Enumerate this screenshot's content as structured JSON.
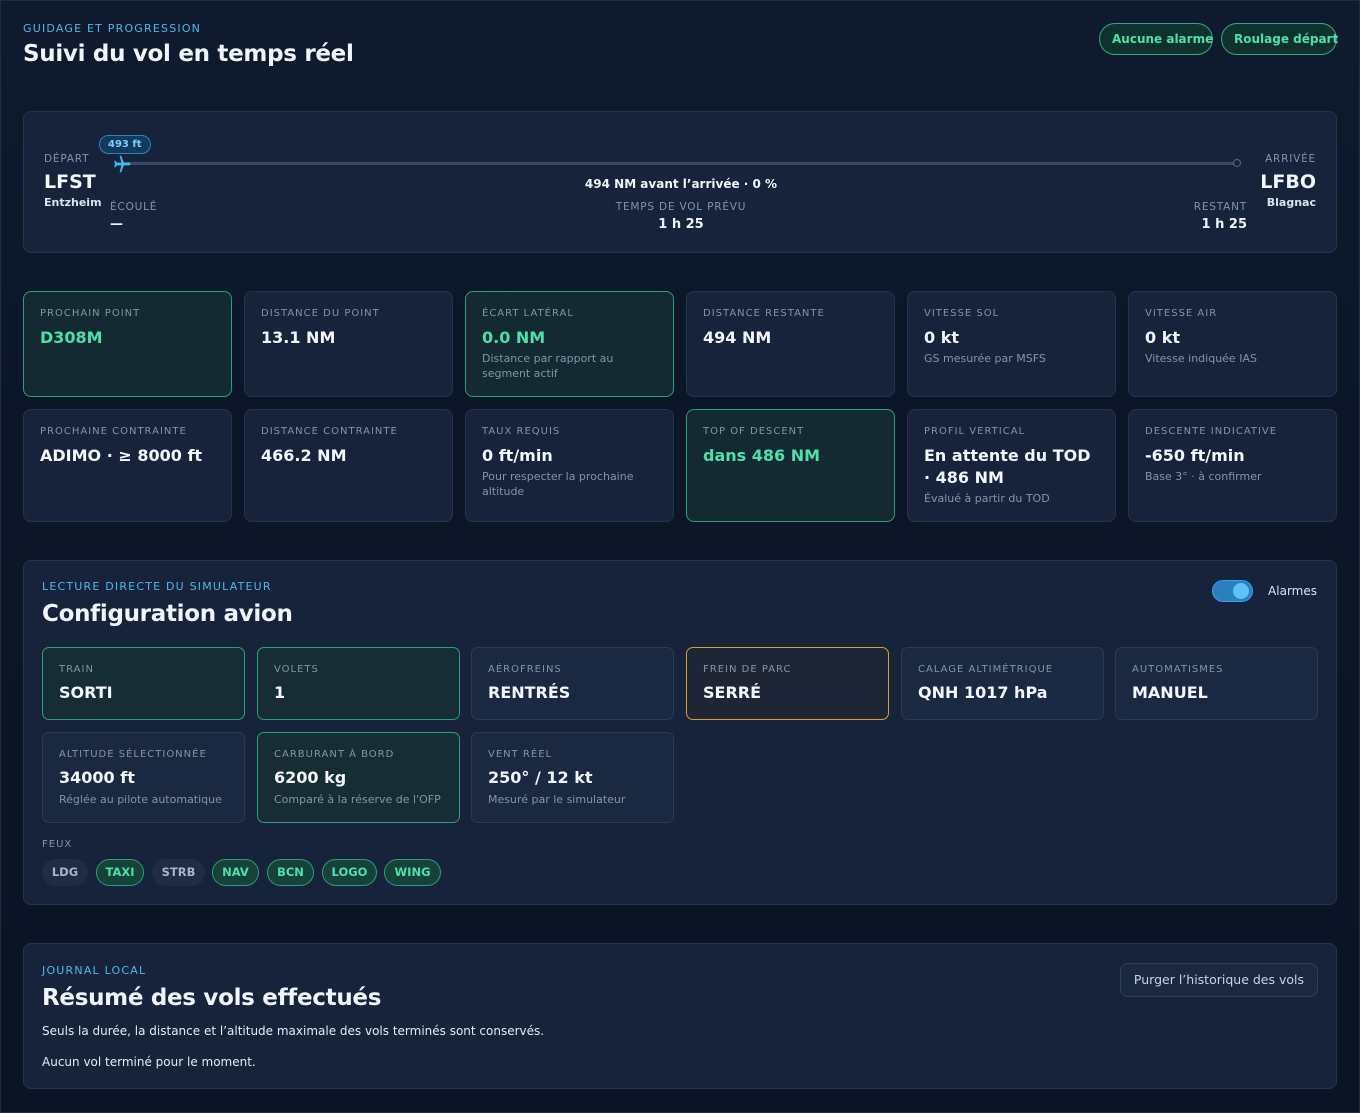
{
  "header": {
    "eyebrow": "GUIDAGE ET PROGRESSION",
    "title": "Suivi du vol en temps réel",
    "alarm_pill": "Aucune alarme",
    "phase_pill": "Roulage départ"
  },
  "route": {
    "departure_label": "DÉPART",
    "departure_icao": "LFST",
    "departure_city": "Entzheim",
    "arrival_label": "ARRIVÉE",
    "arrival_icao": "LFBO",
    "arrival_city": "Blagnac",
    "altitude_badge": "493 ft",
    "progress_fraction": 0,
    "progress_text": "494 NM avant l’arrivée · 0 %",
    "elapsed_label": "ÉCOULÉ",
    "elapsed_value": "—",
    "planned_label": "TEMPS DE VOL PRÉVU",
    "planned_value": "1 h 25",
    "remaining_label": "RESTANT",
    "remaining_value": "1 h 25"
  },
  "metrics": [
    {
      "label": "PROCHAIN POINT",
      "value": "D308M",
      "sub": ""
    },
    {
      "label": "DISTANCE DU POINT",
      "value": "13.1 NM",
      "sub": ""
    },
    {
      "label": "ÉCART LATÉRAL",
      "value": "0.0 NM",
      "sub": "Distance par rapport au segment actif"
    },
    {
      "label": "DISTANCE RESTANTE",
      "value": "494 NM",
      "sub": ""
    },
    {
      "label": "VITESSE SOL",
      "value": "0 kt",
      "sub": "GS mesurée par MSFS"
    },
    {
      "label": "VITESSE AIR",
      "value": "0 kt",
      "sub": "Vitesse indiquée IAS"
    },
    {
      "label": "PROCHAINE CONTRAINTE",
      "value": "ADIMO · ≥ 8000 ft",
      "sub": ""
    },
    {
      "label": "DISTANCE CONTRAINTE",
      "value": "466.2 NM",
      "sub": ""
    },
    {
      "label": "TAUX REQUIS",
      "value": "0 ft/min",
      "sub": "Pour respecter la prochaine altitude"
    },
    {
      "label": "TOP OF DESCENT",
      "value": "dans 486 NM",
      "sub": ""
    },
    {
      "label": "PROFIL VERTICAL",
      "value": "En attente du TOD · 486 NM",
      "sub": "Évalué à partir du TOD"
    },
    {
      "label": "DESCENTE INDICATIVE",
      "value": "-650 ft/min",
      "sub": "Base 3° · à confirmer"
    }
  ],
  "config": {
    "eyebrow": "LECTURE DIRECTE DU SIMULATEUR",
    "title": "Configuration avion",
    "toggle_label": "Alarmes",
    "toggle_on": true,
    "items": [
      {
        "label": "TRAIN",
        "value": "SORTI",
        "sub": ""
      },
      {
        "label": "VOLETS",
        "value": "1",
        "sub": ""
      },
      {
        "label": "AÉROFREINS",
        "value": "RENTRÉS",
        "sub": ""
      },
      {
        "label": "FREIN DE PARC",
        "value": "SERRÉ",
        "sub": ""
      },
      {
        "label": "CALAGE ALTIMÉTRIQUE",
        "value": "QNH 1017 hPa",
        "sub": ""
      },
      {
        "label": "AUTOMATISMES",
        "value": "MANUEL",
        "sub": ""
      },
      {
        "label": "ALTITUDE SÉLECTIONNÉE",
        "value": "34000 ft",
        "sub": "Réglée au pilote automatique"
      },
      {
        "label": "CARBURANT À BORD",
        "value": "6200 kg",
        "sub": "Comparé à la réserve de l'OFP"
      },
      {
        "label": "VENT RÉEL",
        "value": "250° / 12 kt",
        "sub": "Mesuré par le simulateur"
      }
    ],
    "lights_label": "FEUX",
    "lights": [
      {
        "name": "LDG",
        "on": false
      },
      {
        "name": "TAXI",
        "on": true
      },
      {
        "name": "STRB",
        "on": false
      },
      {
        "name": "NAV",
        "on": true
      },
      {
        "name": "BCN",
        "on": true
      },
      {
        "name": "LOGO",
        "on": true
      },
      {
        "name": "WING",
        "on": true
      }
    ]
  },
  "journal": {
    "eyebrow": "JOURNAL LOCAL",
    "title": "Résumé des vols effectués",
    "purge_button": "Purger l’historique des vols",
    "note": "Seuls la durée, la distance et l’altitude maximale des vols terminés sont conservés.",
    "empty": "Aucun vol terminé pour le moment."
  },
  "colors": {
    "accent_blue": "#4cb8ec",
    "accent_green": "#4ee0a8",
    "accent_yellow": "#f5b536",
    "background": "#0c1628"
  }
}
